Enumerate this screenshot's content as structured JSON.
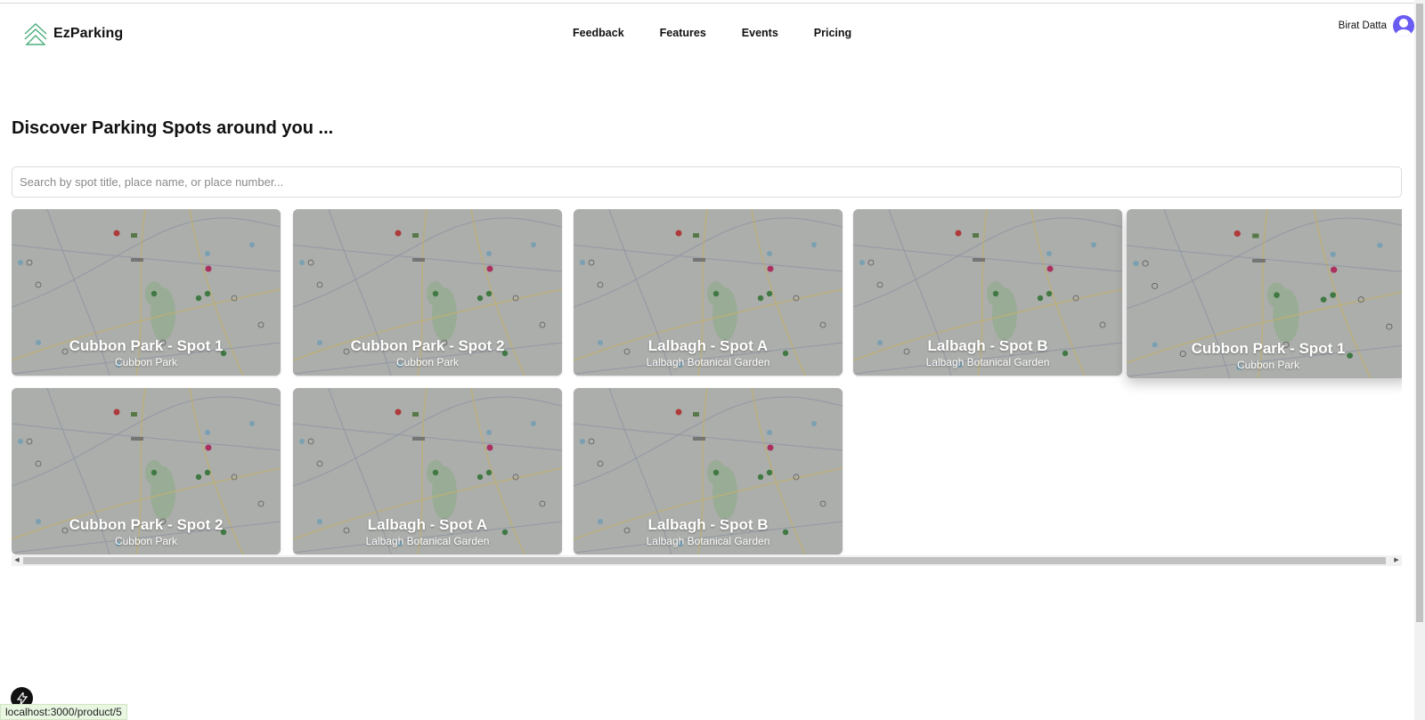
{
  "brand": {
    "name": "EzParking"
  },
  "nav": {
    "links": [
      "Feedback",
      "Features",
      "Events",
      "Pricing"
    ]
  },
  "user": {
    "name": "Birat Datta"
  },
  "page": {
    "heading": "Discover Parking Spots around you ..."
  },
  "search": {
    "placeholder": "Search by spot title, place name, or place number...",
    "value": ""
  },
  "cards": [
    {
      "title": "Cubbon Park - Spot 1",
      "subtitle": "Cubbon Park"
    },
    {
      "title": "Cubbon Park - Spot 2",
      "subtitle": "Cubbon Park"
    },
    {
      "title": "Lalbagh - Spot A",
      "subtitle": "Lalbagh Botanical Garden"
    },
    {
      "title": "Lalbagh - Spot B",
      "subtitle": "Lalbagh Botanical Garden"
    },
    {
      "title": "Cubbon Park - Spot 1",
      "subtitle": "Cubbon Park"
    },
    {
      "title": "Cubbon Park - Spot 2",
      "subtitle": "Cubbon Park"
    },
    {
      "title": "Lalbagh - Spot A",
      "subtitle": "Lalbagh Botanical Garden"
    },
    {
      "title": "Lalbagh - Spot B",
      "subtitle": "Lalbagh Botanical Garden"
    }
  ],
  "status_bar": {
    "url": "localhost:3000/product/5"
  },
  "colors": {
    "accent": "#6a5cf2",
    "logo": "#4caf7d",
    "card_overlay": "#9e9e9e"
  },
  "icons": {
    "logo": "mountain-logo-icon",
    "avatar": "user-avatar-icon",
    "dev_tools": "lightning-bolt-icon"
  }
}
